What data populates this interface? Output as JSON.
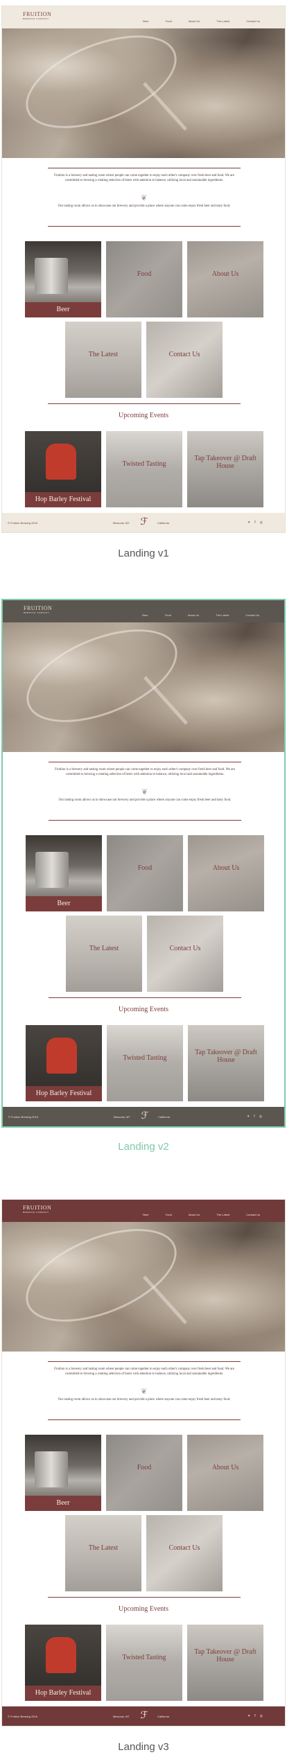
{
  "brand": {
    "logo_word": "FRUITION",
    "logo_sub": "BREWING COMPANY"
  },
  "nav": {
    "items": [
      "Beer",
      "Food",
      "About Us",
      "The Latest",
      "Contact Us"
    ]
  },
  "intro": {
    "paragraph1": "Fruition is a brewery and tasting room where people can come together to enjoy each other's company over fresh beer and food. We are committed to brewing a rotating selection of beers with attention to balance, utilizing local and sustainable ingredients.",
    "paragraph2": "Our tasting room allows us to showcase our brewery and provide a place where anyone can come enjoy fresh beer and tasty food."
  },
  "tiles": {
    "beer": "Beer",
    "food": "Food",
    "about": "About Us",
    "latest": "The Latest",
    "contact": "Contact Us"
  },
  "events": {
    "title": "Upcoming Events",
    "items": [
      "Hop Barley Festival",
      "Twisted Tasting",
      "Tap Takeover @ Draft House"
    ]
  },
  "footer": {
    "copyright": "© Fruition Brewing 2016",
    "location1": "Missoula, MT",
    "location2": "California",
    "social": [
      "twitter-icon",
      "facebook-icon",
      "instagram-icon"
    ]
  },
  "captions": {
    "v1": "Landing v1",
    "v2": "Landing v2",
    "v3": "Landing v3"
  },
  "colors": {
    "maroon": "#7a3d3b",
    "cream": "#efe9df",
    "charcoal": "#5b5650",
    "accent_green": "#7fc9a9"
  }
}
